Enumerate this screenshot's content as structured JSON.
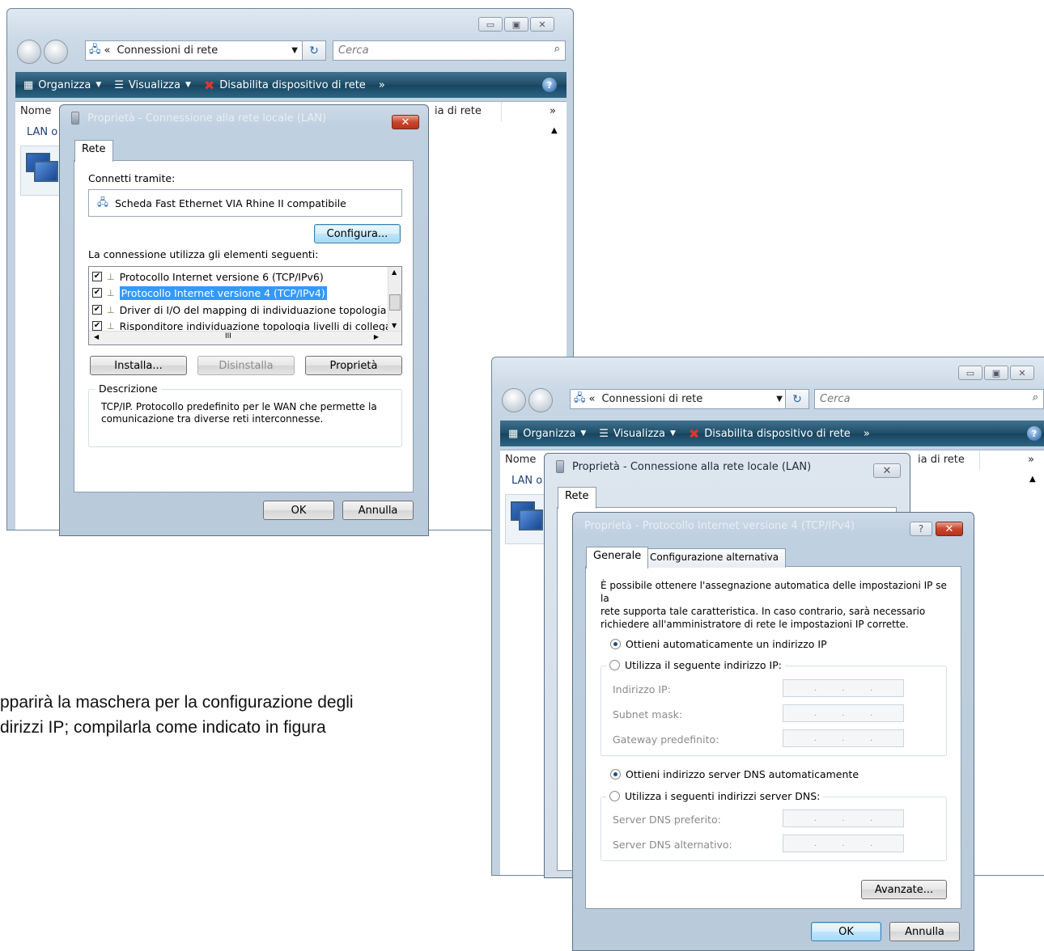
{
  "explorer": {
    "breadcrumb": "Connessioni di rete",
    "search_placeholder": "Cerca",
    "toolbar": {
      "organize": "Organizza",
      "views": "Visualizza",
      "disable": "Disabilita dispositivo di rete",
      "more": "»"
    },
    "columns": {
      "name": "Nome",
      "network": "ia di rete",
      "more": "»"
    },
    "item_label": "LAN o"
  },
  "lan_dialog": {
    "title": "Proprietà - Connessione alla rete locale (LAN)",
    "tab": "Rete",
    "connect_using_label": "Connetti tramite:",
    "adapter": "Scheda Fast Ethernet VIA Rhine II compatibile",
    "configure_button": "Configura...",
    "items_label": "La connessione utilizza gli elementi seguenti:",
    "items": [
      {
        "label": "Protocollo Internet versione 6 (TCP/IPv6)",
        "checked": true
      },
      {
        "label": "Protocollo Internet versione 4 (TCP/IPv4)",
        "checked": true,
        "selected": true
      },
      {
        "label": "Driver di I/O del mapping di individuazione topologia liv",
        "checked": true
      },
      {
        "label": "Risponditore individuazione topologia livelli di collegam",
        "checked": true
      }
    ],
    "hscroll_grip": "III",
    "install_button": "Installa...",
    "uninstall_button": "Disinstalla",
    "properties_button": "Proprietà",
    "description_label": "Descrizione",
    "description_text": "TCP/IP. Protocollo predefinito per le WAN che permette la comunicazione tra diverse reti interconnesse.",
    "ok_button": "OK",
    "cancel_button": "Annulla"
  },
  "caption": {
    "line1": "pparirà la maschera per la configurazione degli",
    "line2": "dirizzi IP; compilarla come indicato in figura"
  },
  "ipv4_dialog": {
    "title": "Proprietà - Protocollo Internet versione 4 (TCP/IPv4)",
    "help": "?",
    "tab_general": "Generale",
    "tab_alternate": "Configurazione alternativa",
    "intro": [
      "È possibile ottenere l'assegnazione automatica delle impostazioni IP se la",
      "rete supporta tale caratteristica. In caso contrario, sarà necessario",
      "richiedere all'amministratore di rete le impostazioni IP corrette."
    ],
    "auto_ip": "Ottieni automaticamente un indirizzo IP",
    "manual_ip": "Utilizza il seguente indirizzo IP:",
    "ip_address": "Indirizzo IP:",
    "subnet_mask": "Subnet mask:",
    "gateway": "Gateway predefinito:",
    "auto_dns": "Ottieni indirizzo server DNS automaticamente",
    "manual_dns": "Utilizza i seguenti indirizzi server DNS:",
    "preferred_dns": "Server DNS preferito:",
    "alternate_dns": "Server DNS alternativo:",
    "advanced_button": "Avanzate...",
    "ok_button": "OK",
    "cancel_button": "Annulla",
    "ip_dot": "."
  },
  "colors": {
    "toolbar": "#1e4d66",
    "close": "#c9452d",
    "selection": "#3399ff"
  }
}
